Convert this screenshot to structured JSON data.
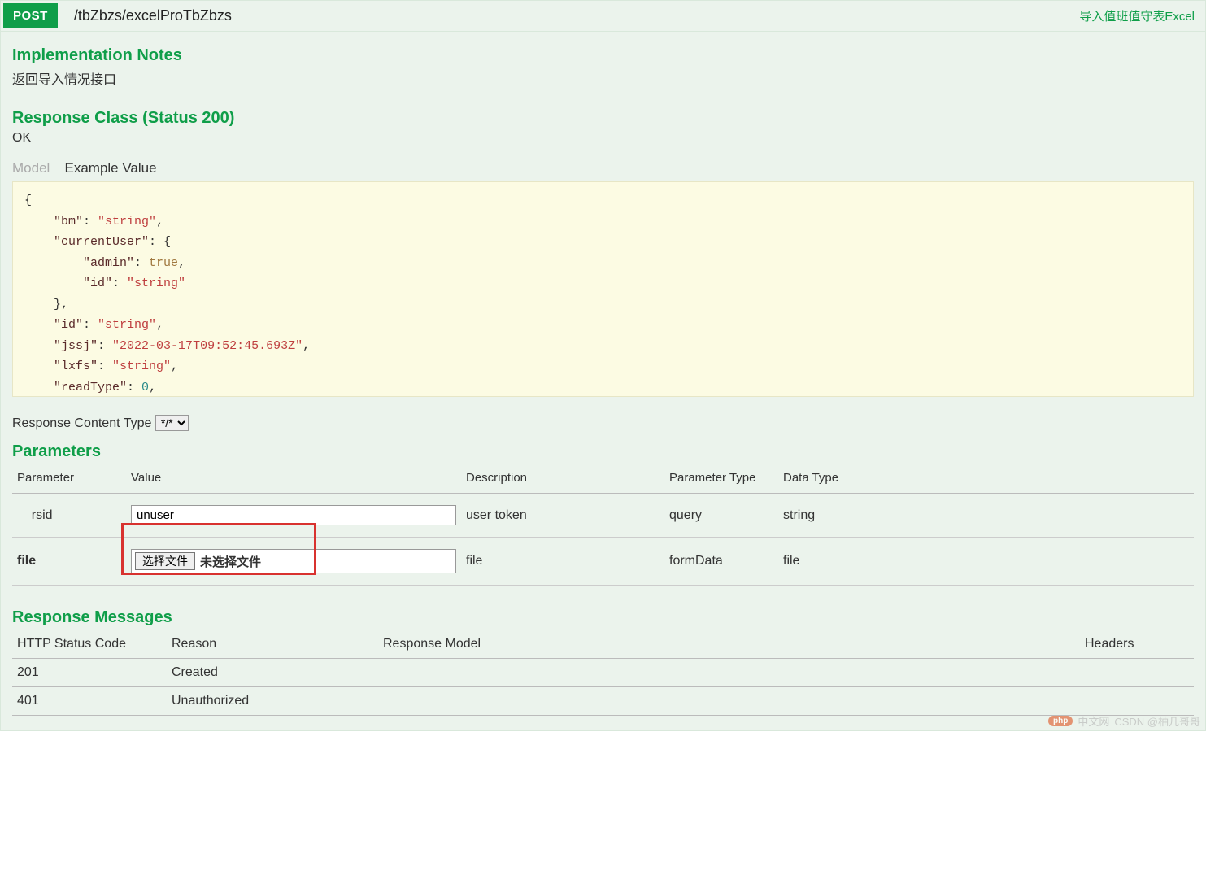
{
  "header": {
    "method": "POST",
    "path": "/tbZbzs/excelProTbZbzs",
    "summary": "导入值班值守表Excel"
  },
  "notes": {
    "heading": "Implementation Notes",
    "text": "返回导入情况接口"
  },
  "responseClass": {
    "heading": "Response Class (Status 200)",
    "status": "OK",
    "tabs": {
      "model": "Model",
      "example": "Example Value"
    },
    "exampleLines": [
      {
        "t": "plain",
        "v": "{"
      },
      {
        "t": "kv",
        "k": "\"bm\"",
        "v": "\"string\"",
        "vt": "s",
        "comma": true,
        "indent": 2
      },
      {
        "t": "kopen",
        "k": "\"currentUser\"",
        "indent": 2
      },
      {
        "t": "kv",
        "k": "\"admin\"",
        "v": "true",
        "vt": "b",
        "comma": true,
        "indent": 4
      },
      {
        "t": "kv",
        "k": "\"id\"",
        "v": "\"string\"",
        "vt": "s",
        "comma": false,
        "indent": 4
      },
      {
        "t": "close",
        "indent": 2,
        "comma": true
      },
      {
        "t": "kv",
        "k": "\"id\"",
        "v": "\"string\"",
        "vt": "s",
        "comma": true,
        "indent": 2
      },
      {
        "t": "kv",
        "k": "\"jssj\"",
        "v": "\"2022-03-17T09:52:45.693Z\"",
        "vt": "s",
        "comma": true,
        "indent": 2
      },
      {
        "t": "kv",
        "k": "\"lxfs\"",
        "v": "\"string\"",
        "vt": "s",
        "comma": true,
        "indent": 2
      },
      {
        "t": "kv",
        "k": "\"readType\"",
        "v": "0",
        "vt": "n",
        "comma": true,
        "indent": 2
      }
    ]
  },
  "contentTypeRow": {
    "label": "Response Content Type",
    "selected": "*/*"
  },
  "parameters": {
    "heading": "Parameters",
    "columns": {
      "parameter": "Parameter",
      "value": "Value",
      "description": "Description",
      "parameterType": "Parameter Type",
      "dataType": "Data Type"
    },
    "rows": [
      {
        "name": "__rsid",
        "value": "unuser",
        "description": "user token",
        "paramType": "query",
        "dataType": "string",
        "input": "text"
      },
      {
        "name": "file",
        "fileButton": "选择文件",
        "fileStatus": "未选择文件",
        "description": "file",
        "paramType": "formData",
        "dataType": "file",
        "input": "file"
      }
    ]
  },
  "responseMessages": {
    "heading": "Response Messages",
    "columns": {
      "code": "HTTP Status Code",
      "reason": "Reason",
      "model": "Response Model",
      "headers": "Headers"
    },
    "rows": [
      {
        "code": "201",
        "reason": "Created"
      },
      {
        "code": "401",
        "reason": "Unauthorized"
      }
    ]
  },
  "footer": {
    "phpBadge": "php",
    "site": "中文网",
    "credit": "CSDN @柚几哥哥"
  }
}
